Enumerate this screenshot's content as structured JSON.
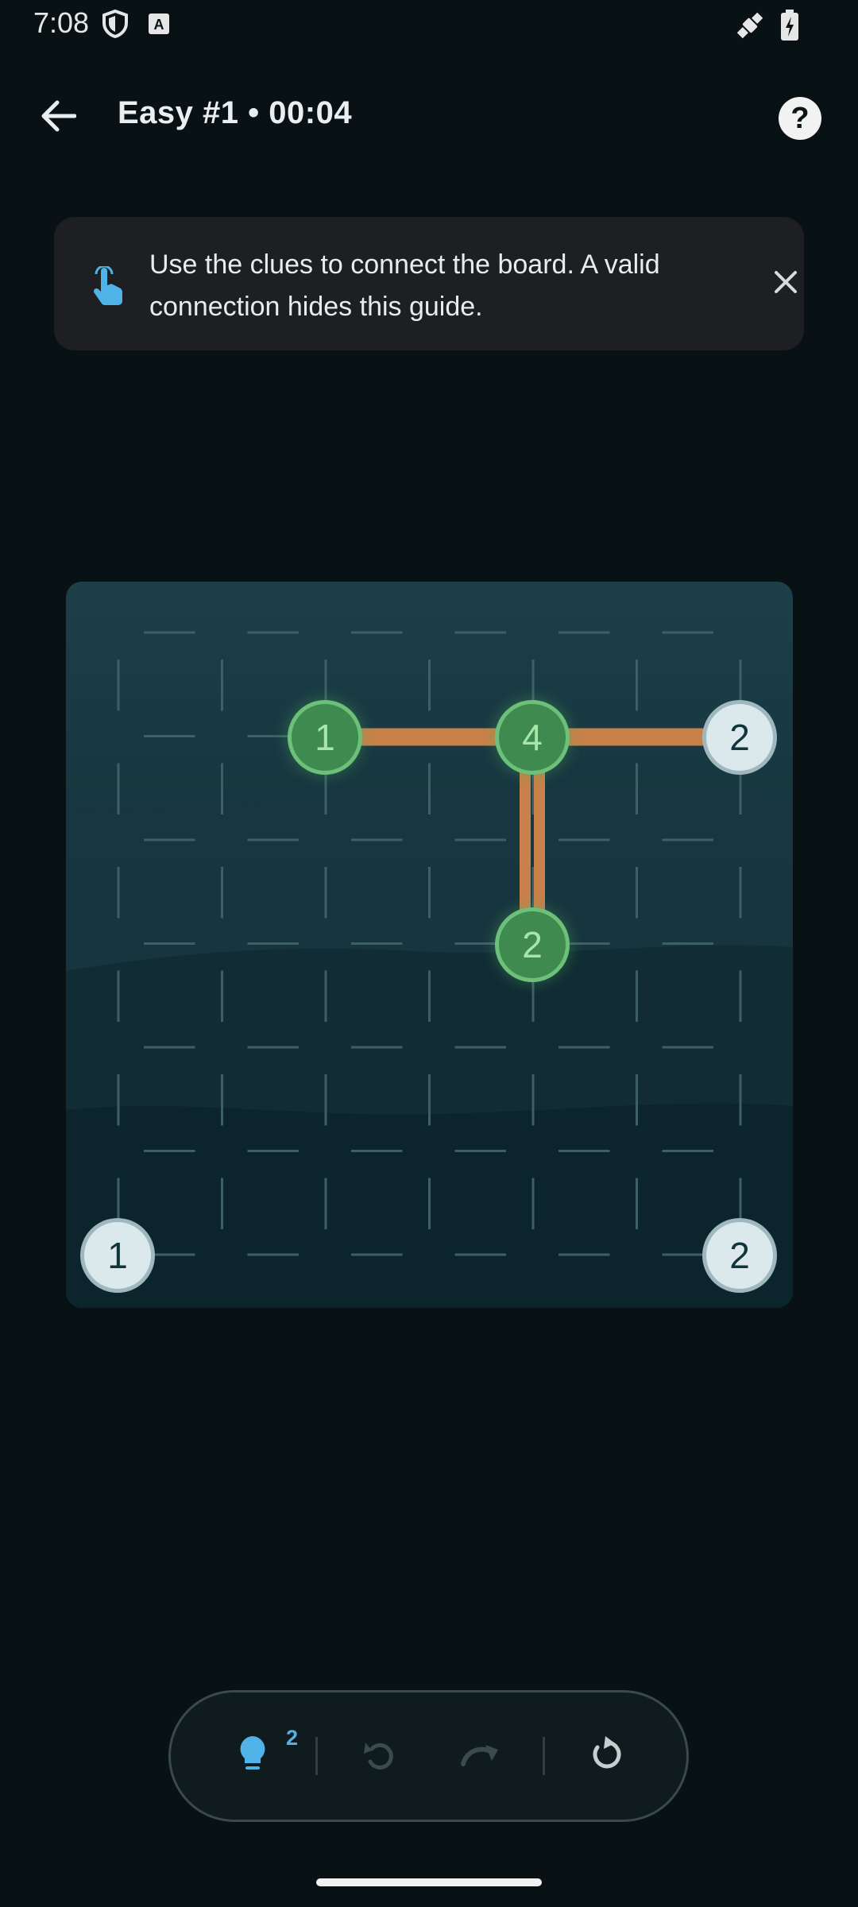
{
  "status_bar": {
    "time": "7:08",
    "icons": [
      "shield-icon",
      "keyboard-a-icon",
      "satellite-icon",
      "battery-charging-icon"
    ]
  },
  "header": {
    "title": "Easy #1 • 00:04",
    "back_icon": "arrow-back-icon",
    "help_icon": "help-circle-icon",
    "help_glyph": "?"
  },
  "guide": {
    "text": "Use the clues to connect the board. A valid connection hides this guide.",
    "icon": "tap-hand-icon",
    "close_icon": "close-icon"
  },
  "board": {
    "grid_size": 7,
    "islands": [
      {
        "row": 1,
        "col": 2,
        "value": "1",
        "state": "complete"
      },
      {
        "row": 1,
        "col": 4,
        "value": "4",
        "state": "complete"
      },
      {
        "row": 1,
        "col": 6,
        "value": "2",
        "state": "open"
      },
      {
        "row": 3,
        "col": 4,
        "value": "2",
        "state": "complete"
      },
      {
        "row": 6,
        "col": 0,
        "value": "1",
        "state": "open"
      },
      {
        "row": 6,
        "col": 6,
        "value": "2",
        "state": "open"
      }
    ],
    "bridges": [
      {
        "from": [
          1,
          2
        ],
        "to": [
          1,
          4
        ],
        "count": 1
      },
      {
        "from": [
          1,
          4
        ],
        "to": [
          1,
          6
        ],
        "count": 1
      },
      {
        "from": [
          1,
          4
        ],
        "to": [
          3,
          4
        ],
        "count": 2
      }
    ],
    "colors": {
      "complete_fill": "#3f8a4e",
      "complete_ring": "#6cc07a",
      "open_fill": "#dbe8ec",
      "bridge": "#c8814a"
    }
  },
  "toolbar": {
    "hint_icon": "lightbulb-icon",
    "hint_count": "2",
    "undo_icon": "undo-icon",
    "redo_icon": "redo-icon",
    "reset_icon": "reset-icon"
  }
}
